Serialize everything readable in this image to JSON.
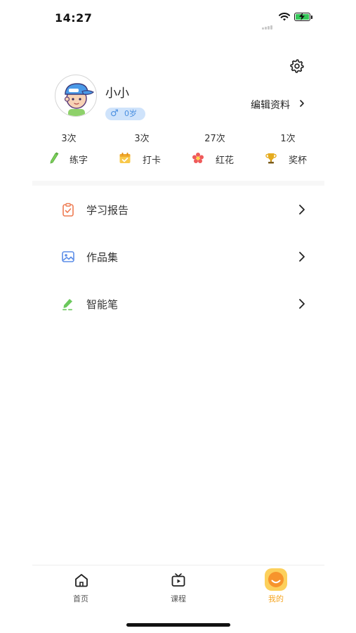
{
  "status_bar": {
    "time": "14:27"
  },
  "profile": {
    "username": "小小",
    "gender_symbol": "♂",
    "age": "0岁",
    "edit_label": "编辑资料"
  },
  "stats": [
    {
      "count": "3次",
      "label": "练字",
      "icon": "pencil-icon"
    },
    {
      "count": "3次",
      "label": "打卡",
      "icon": "calendar-check-icon"
    },
    {
      "count": "27次",
      "label": "红花",
      "icon": "red-flower-icon"
    },
    {
      "count": "1次",
      "label": "奖杯",
      "icon": "trophy-icon"
    }
  ],
  "menu": [
    {
      "label": "学习报告",
      "icon": "clipboard-report-icon"
    },
    {
      "label": "作品集",
      "icon": "picture-gallery-icon"
    },
    {
      "label": "智能笔",
      "icon": "smart-pen-icon"
    }
  ],
  "tabbar": {
    "items": [
      {
        "label": "首页",
        "icon": "home-icon"
      },
      {
        "label": "课程",
        "icon": "tv-play-icon"
      },
      {
        "label": "我的",
        "icon": "smiley-face-icon",
        "active": true
      }
    ],
    "active_color": "#f5a623"
  },
  "colors": {
    "badge_bg": "#cfe3fb",
    "badge_text": "#4a8fe0",
    "battery_fill": "#35c759"
  }
}
